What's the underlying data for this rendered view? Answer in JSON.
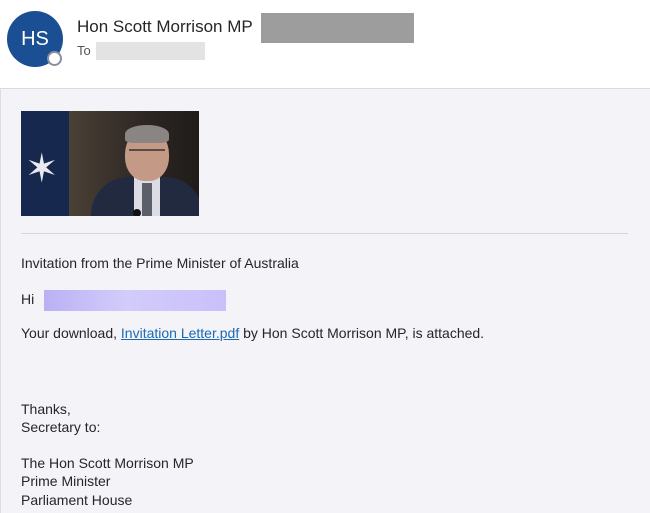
{
  "header": {
    "avatar_initials": "HS",
    "sender_name": "Hon Scott Morrison MP",
    "to_label": "To"
  },
  "email": {
    "image_alt": "Prime Minister portrait photo",
    "subject_line": "Invitation from the Prime Minister of Australia",
    "greeting": "Hi",
    "download_prefix": "Your download, ",
    "attachment_link": "Invitation Letter.pdf",
    "download_suffix": " by Hon Scott Morrison MP, is attached.",
    "signoff": "Thanks,",
    "secretary": "Secretary to:",
    "signature_name": "The Hon Scott Morrison MP",
    "signature_title": "Prime Minister",
    "signature_address": "Parliament House"
  },
  "colors": {
    "avatar": "#1b4f93",
    "link": "#1b6ab3",
    "redaction_gray": "#9d9d9d",
    "redaction_purple": "#c9c0fb"
  }
}
